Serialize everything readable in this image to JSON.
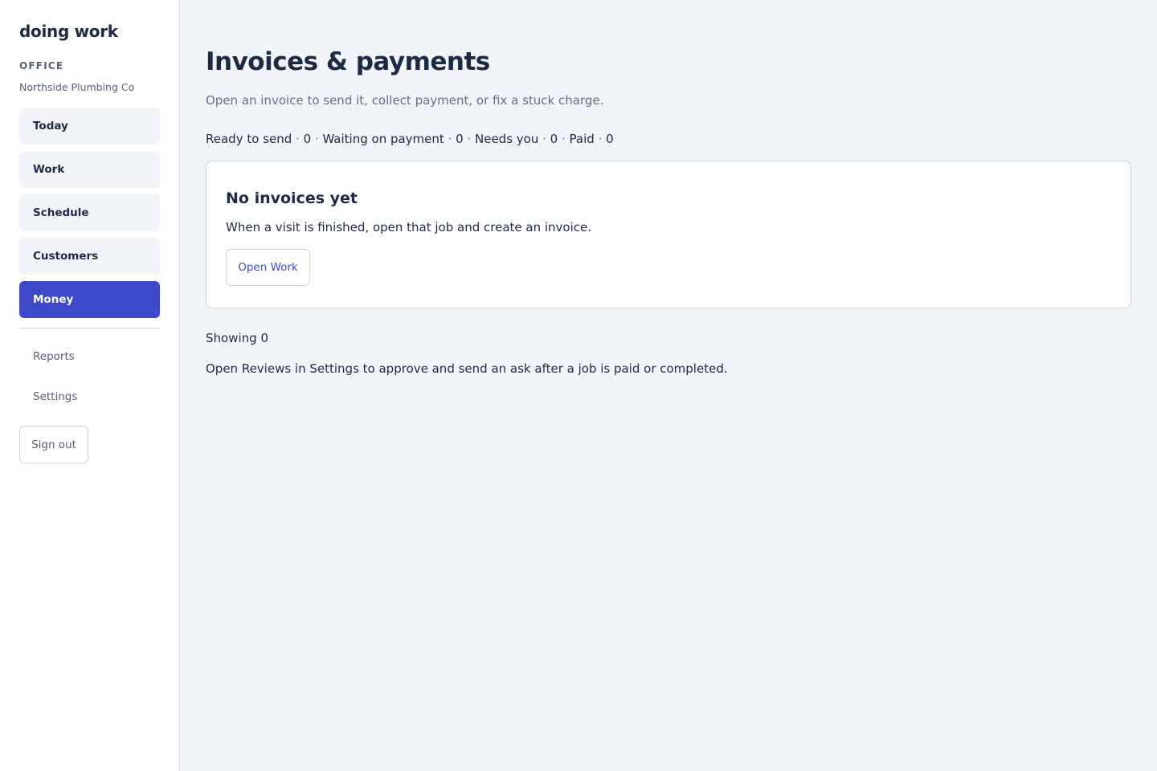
{
  "sidebar": {
    "brand": "doing work",
    "section_label": "OFFICE",
    "org_name": "Northside Plumbing Co",
    "nav": [
      {
        "label": "Today"
      },
      {
        "label": "Work"
      },
      {
        "label": "Schedule"
      },
      {
        "label": "Customers"
      },
      {
        "label": "Money",
        "active": true
      }
    ],
    "secondary": [
      {
        "label": "Reports"
      },
      {
        "label": "Settings"
      }
    ],
    "sign_out": "Sign out"
  },
  "main": {
    "title": "Invoices & payments",
    "subtitle": "Open an invoice to send it, collect payment, or fix a stuck charge.",
    "counts": [
      {
        "label": "Ready to send",
        "value": "0"
      },
      {
        "label": "Waiting on payment",
        "value": "0"
      },
      {
        "label": "Needs you",
        "value": "0"
      },
      {
        "label": "Paid",
        "value": "0"
      }
    ],
    "empty_state": {
      "title": "No invoices yet",
      "text": "When a visit is finished, open that job and create an invoice.",
      "button": "Open Work"
    },
    "showing": "Showing 0",
    "reviews_note": "Open Reviews in Settings to approve and send an ask after a job is paid or completed."
  },
  "colors": {
    "accent": "#4049c7",
    "background": "#f1f4f9",
    "text": "#1e2a44",
    "muted": "#556177"
  }
}
